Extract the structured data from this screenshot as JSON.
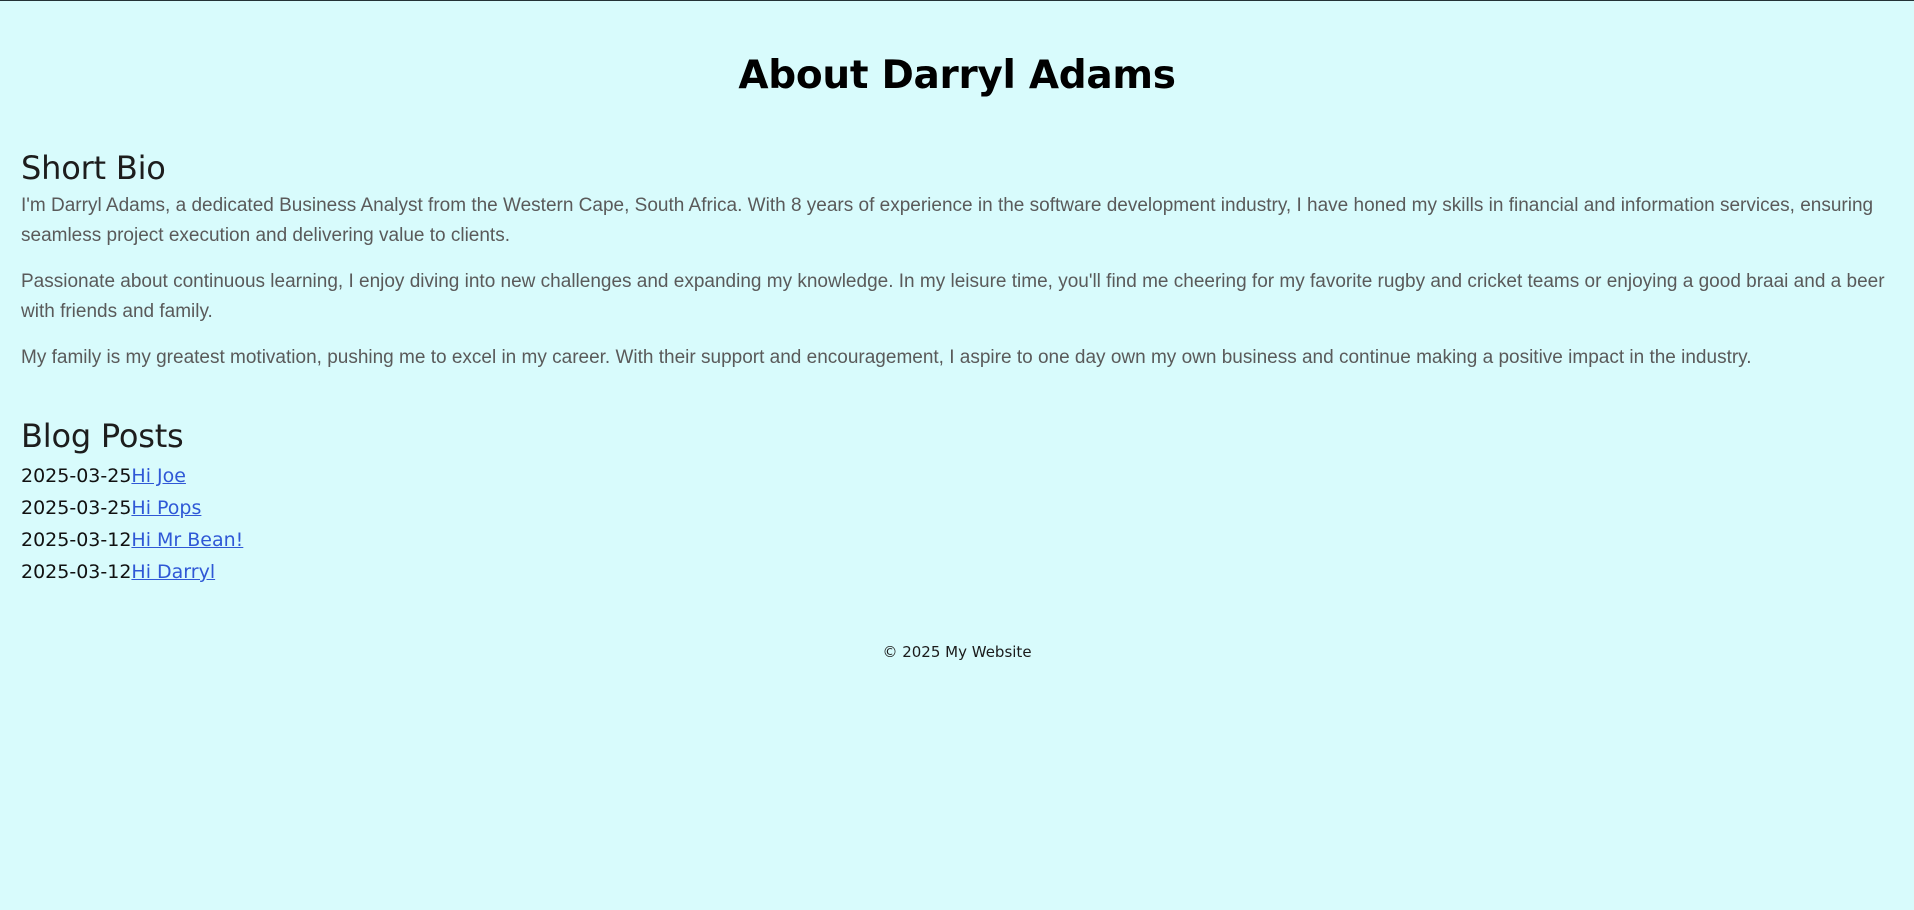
{
  "page": {
    "title": "About Darryl Adams"
  },
  "bio": {
    "heading": "Short Bio",
    "paragraphs": [
      "I'm Darryl Adams, a dedicated Business Analyst from the Western Cape, South Africa. With 8 years of experience in the software development industry, I have honed my skills in financial and information services, ensuring seamless project execution and delivering value to clients.",
      "Passionate about continuous learning, I enjoy diving into new challenges and expanding my knowledge. In my leisure time, you'll find me cheering for my favorite rugby and cricket teams or enjoying a good braai and a beer with friends and family.",
      "My family is my greatest motivation, pushing me to excel in my career. With their support and encouragement, I aspire to one day own my own business and continue making a positive impact in the industry."
    ]
  },
  "blog": {
    "heading": "Blog Posts",
    "posts": [
      {
        "date": "2025-03-25",
        "title": "Hi Joe"
      },
      {
        "date": "2025-03-25",
        "title": "Hi Pops"
      },
      {
        "date": "2025-03-12",
        "title": "Hi Mr Bean!"
      },
      {
        "date": "2025-03-12",
        "title": "Hi Darryl"
      }
    ]
  },
  "footer": {
    "text": "© 2025 My Website"
  },
  "colors": {
    "background": "#d8fbfc",
    "link": "#2f58d6",
    "body_text": "#5a5a5a"
  }
}
